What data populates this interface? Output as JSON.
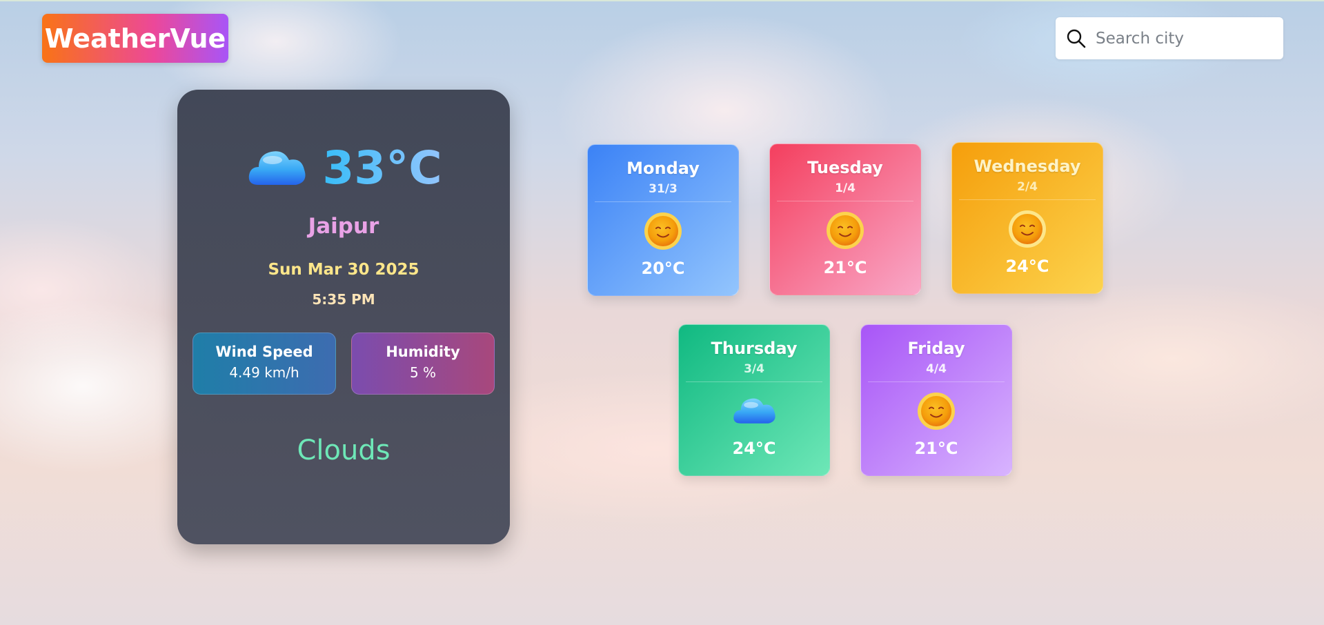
{
  "app": {
    "logo": "WeatherVue"
  },
  "search": {
    "placeholder": "Search city"
  },
  "current": {
    "icon": "cloud-icon",
    "temperature": "33°C",
    "city": "Jaipur",
    "date": "Sun Mar 30 2025",
    "time": "5:35 PM",
    "wind": {
      "label": "Wind Speed",
      "value": "4.49 km/h"
    },
    "humidity": {
      "label": "Humidity",
      "value": "5 %"
    },
    "condition": "Clouds"
  },
  "forecast": [
    {
      "day": "Monday",
      "date": "31/3",
      "icon": "sun-icon",
      "temp": "20°C"
    },
    {
      "day": "Tuesday",
      "date": "1/4",
      "icon": "sun-icon",
      "temp": "21°C"
    },
    {
      "day": "Wednesday",
      "date": "2/4",
      "icon": "sun-icon",
      "temp": "24°C"
    },
    {
      "day": "Thursday",
      "date": "3/4",
      "icon": "cloud-icon",
      "temp": "24°C"
    },
    {
      "day": "Friday",
      "date": "4/4",
      "icon": "sun-icon",
      "temp": "21°C"
    }
  ]
}
